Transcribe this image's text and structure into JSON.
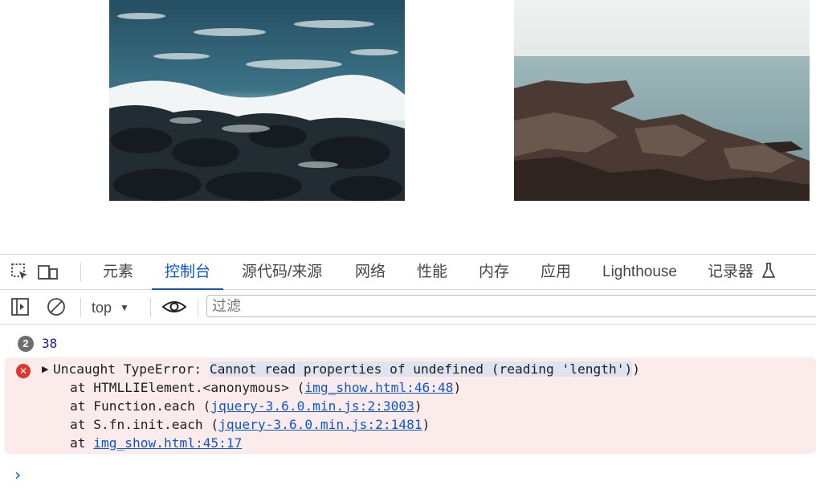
{
  "images": [
    {
      "name": "ocean-waves-rocks-photo"
    },
    {
      "name": "rocky-coast-sea-photo"
    }
  ],
  "devtools": {
    "tabs": [
      {
        "label": "元素"
      },
      {
        "label": "控制台"
      },
      {
        "label": "源代码/来源"
      },
      {
        "label": "网络"
      },
      {
        "label": "性能"
      },
      {
        "label": "内存"
      },
      {
        "label": "应用"
      },
      {
        "label": "Lighthouse"
      },
      {
        "label": "记录器"
      }
    ],
    "active_tab": "控制台",
    "filterbar": {
      "context": "top",
      "filter_placeholder": "过滤"
    }
  },
  "console": {
    "log": {
      "count": "2",
      "value": "38"
    },
    "error": {
      "type": "Uncaught TypeError:",
      "message": "Cannot read properties of undefined (reading 'length')",
      "close_paren": ")",
      "stack": [
        {
          "prefix": "at HTMLLIElement.<anonymous> (",
          "link": "img_show.html:46:48",
          "suffix": ")"
        },
        {
          "prefix": "at Function.each (",
          "link": "jquery-3.6.0.min.js:2:3003",
          "suffix": ")"
        },
        {
          "prefix": "at S.fn.init.each (",
          "link": "jquery-3.6.0.min.js:2:1481",
          "suffix": ")"
        },
        {
          "prefix": "at ",
          "link": "img_show.html:45:17",
          "suffix": ""
        }
      ]
    },
    "prompt": "›"
  },
  "colors": {
    "accent": "#0b57d0",
    "error_bg": "#fcebeb",
    "error_icon": "#dc362e"
  }
}
